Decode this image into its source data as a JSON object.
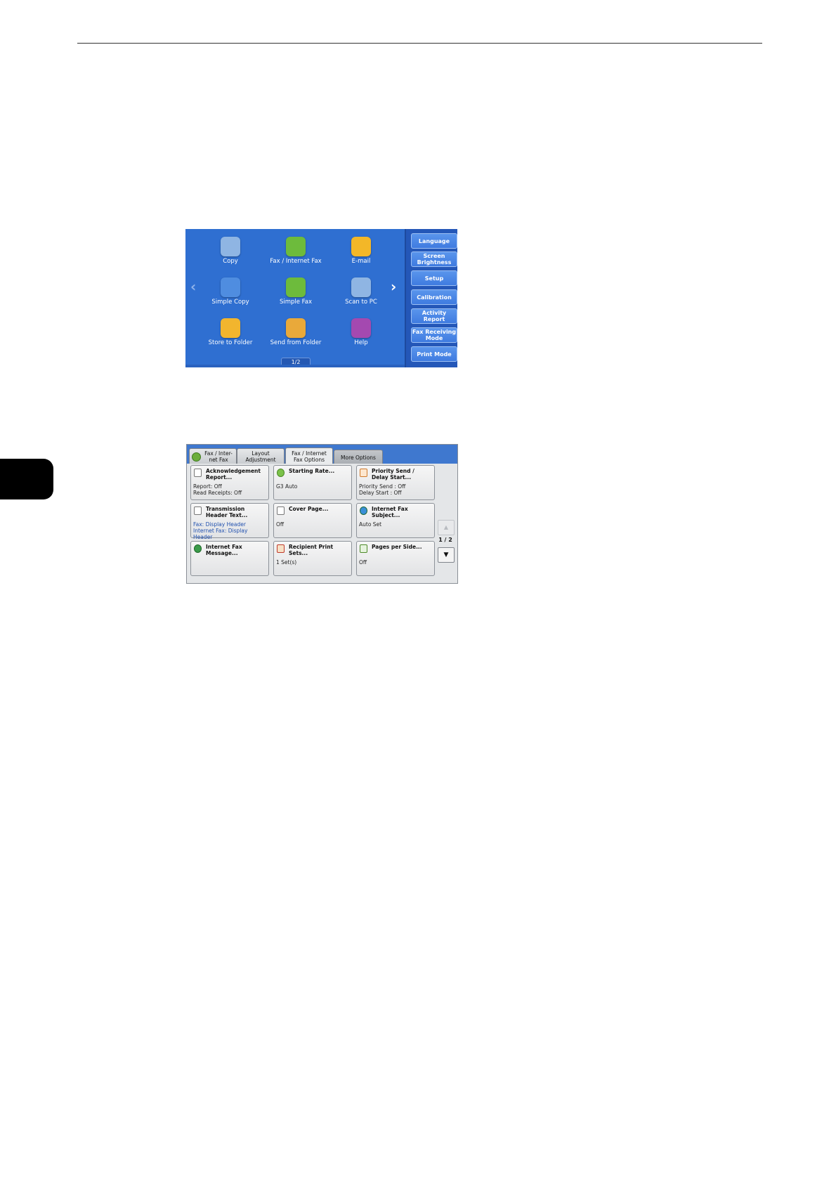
{
  "home_screen": {
    "apps": [
      {
        "label": "Copy",
        "icon": "copy-icon",
        "color": "#8fb5e3"
      },
      {
        "label": "Fax / Internet Fax",
        "icon": "fax-icon",
        "color": "#6dbb3c"
      },
      {
        "label": "E-mail",
        "icon": "email-icon",
        "color": "#f3b728"
      },
      {
        "label": "Simple Copy",
        "icon": "simple-copy-icon",
        "color": "#4f8de0"
      },
      {
        "label": "Simple Fax",
        "icon": "simple-fax-icon",
        "color": "#6dbb3c"
      },
      {
        "label": "Scan to PC",
        "icon": "scan-to-pc-icon",
        "color": "#8fb5e3"
      },
      {
        "label": "Store to Folder",
        "icon": "folder-icon",
        "color": "#f2b52e"
      },
      {
        "label": "Send from Folder",
        "icon": "send-from-folder-icon",
        "color": "#e9a93a"
      },
      {
        "label": "Help",
        "icon": "help-icon",
        "color": "#a449b0"
      }
    ],
    "page_indicator": "1/2",
    "side_buttons": [
      "Language",
      "Screen Brightness",
      "Setup",
      "Calibration",
      "Activity Report",
      "Fax Receiving Mode",
      "Print Mode"
    ]
  },
  "fax_options": {
    "tabs": [
      {
        "label": "Fax / Inter- net Fax"
      },
      {
        "label": "Layout Adjustment"
      },
      {
        "label": "Fax / Internet Fax Options"
      },
      {
        "label": "More Options"
      }
    ],
    "cells": [
      {
        "title": "Acknowledgement Report...",
        "value": "Report: Off\nRead Receipts: Off"
      },
      {
        "title": "Starting Rate...",
        "value": "G3 Auto"
      },
      {
        "title": "Priority Send / Delay Start...",
        "value": "Priority Send : Off\nDelay Start : Off"
      },
      {
        "title": "Transmission Header Text...",
        "value": "Fax: Display Header\nInternet Fax: Display Header"
      },
      {
        "title": "Cover Page...",
        "value": "Off"
      },
      {
        "title": "Internet Fax Subject...",
        "value": "Auto Set"
      },
      {
        "title": "Internet Fax Message...",
        "value": ""
      },
      {
        "title": "Recipient Print Sets...",
        "value": "1 Set(s)"
      },
      {
        "title": "Pages per Side...",
        "value": "Off"
      }
    ],
    "page_indicator": "1 / 2",
    "scroll_up_glyph": "▲",
    "scroll_down_glyph": "▼"
  }
}
